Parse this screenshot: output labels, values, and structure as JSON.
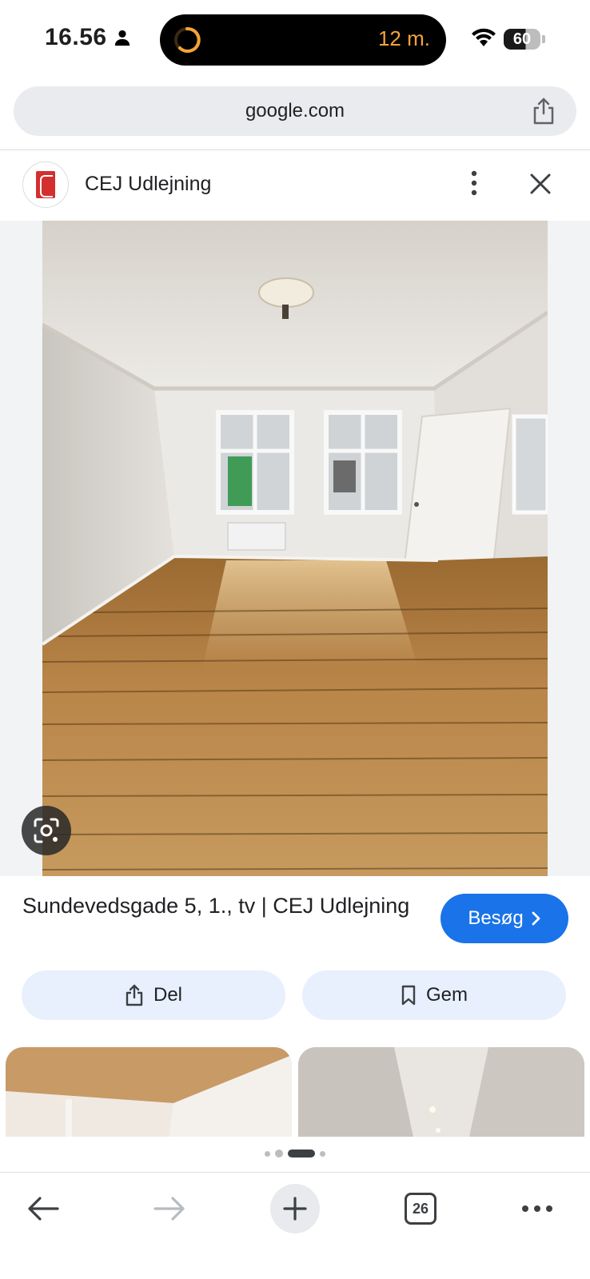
{
  "status_bar": {
    "time": "16.56",
    "activity_timer": "12 m.",
    "battery_level": "60"
  },
  "url_bar": {
    "url": "google.com"
  },
  "result": {
    "source_name": "CEJ Udlejning",
    "title": "Sundevedsgade 5, 1., tv | CEJ Udlejning",
    "visit_label": "Besøg",
    "share_label": "Del",
    "save_label": "Gem"
  },
  "carousel": {
    "page_count": 4,
    "active_index": 2
  },
  "toolbar": {
    "tab_count": "26"
  },
  "colors": {
    "accent": "#1a73e8",
    "chip_background": "#e8f0fe",
    "timer": "#f5a33a"
  }
}
